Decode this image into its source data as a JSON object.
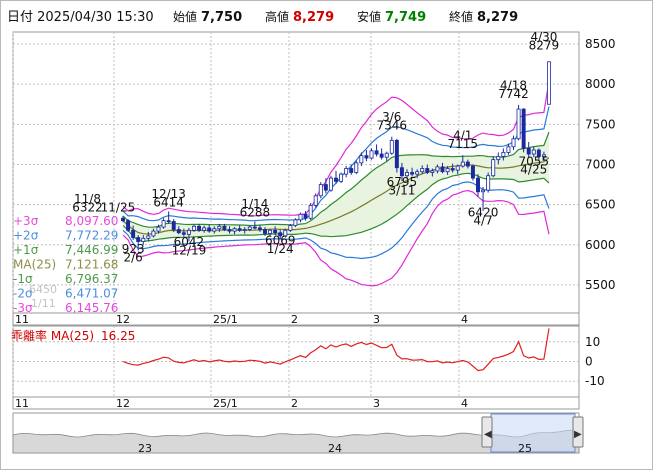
{
  "header": {
    "datetime": "日付 2025/04/30 15:30",
    "open_label": "始値",
    "open": "7,750",
    "high_label": "高値",
    "high": "8,279",
    "low_label": "安値",
    "low": "7,749",
    "close_label": "終値",
    "close": "8,279"
  },
  "colors": {
    "up_candle": "#ffffff",
    "down_candle": "#1a2a9e",
    "candle_edge": "#1a2a9e",
    "ma25": "#7a7a2a",
    "sigma1": "#2e8b2e",
    "sigma2": "#2a7ad8",
    "sigma3": "#e02ad8",
    "band_fill": "#e8f3e0",
    "grid": "#c0c0c0",
    "high_value": "#d00000",
    "low_value": "#008000",
    "deviation_line": "#e02020",
    "navigator_fill": "#c8d8f8"
  },
  "chart_data": {
    "type": "candlestick",
    "main_y_ticks": [
      "8500",
      "8000",
      "7500",
      "7000",
      "6500",
      "6000",
      "5500"
    ],
    "main_ylim": [
      5150,
      8650
    ],
    "x_month_labels": [
      "11",
      "12",
      "25/1",
      "2",
      "3",
      "4"
    ],
    "candles": [
      {
        "o": 6330,
        "h": 6360,
        "l": 6280,
        "c": 6300
      },
      {
        "o": 6300,
        "h": 6320,
        "l": 6160,
        "c": 6180
      },
      {
        "o": 6180,
        "h": 6240,
        "l": 6060,
        "c": 6090
      },
      {
        "o": 6090,
        "h": 6120,
        "l": 5930,
        "c": 6040
      },
      {
        "o": 6040,
        "h": 6120,
        "l": 6000,
        "c": 6080
      },
      {
        "o": 6080,
        "h": 6160,
        "l": 6040,
        "c": 6110
      },
      {
        "o": 6110,
        "h": 6200,
        "l": 6090,
        "c": 6170
      },
      {
        "o": 6170,
        "h": 6250,
        "l": 6140,
        "c": 6220
      },
      {
        "o": 6220,
        "h": 6330,
        "l": 6200,
        "c": 6300
      },
      {
        "o": 6300,
        "h": 6414,
        "l": 6260,
        "c": 6290
      },
      {
        "o": 6290,
        "h": 6320,
        "l": 6160,
        "c": 6190
      },
      {
        "o": 6190,
        "h": 6230,
        "l": 6130,
        "c": 6150
      },
      {
        "o": 6150,
        "h": 6200,
        "l": 6100,
        "c": 6130
      },
      {
        "o": 6130,
        "h": 6210,
        "l": 6042,
        "c": 6180
      },
      {
        "o": 6180,
        "h": 6250,
        "l": 6160,
        "c": 6230
      },
      {
        "o": 6230,
        "h": 6260,
        "l": 6160,
        "c": 6180
      },
      {
        "o": 6180,
        "h": 6240,
        "l": 6150,
        "c": 6210
      },
      {
        "o": 6210,
        "h": 6250,
        "l": 6150,
        "c": 6170
      },
      {
        "o": 6170,
        "h": 6230,
        "l": 6140,
        "c": 6200
      },
      {
        "o": 6200,
        "h": 6260,
        "l": 6160,
        "c": 6230
      },
      {
        "o": 6230,
        "h": 6260,
        "l": 6170,
        "c": 6190
      },
      {
        "o": 6190,
        "h": 6230,
        "l": 6140,
        "c": 6170
      },
      {
        "o": 6170,
        "h": 6220,
        "l": 6130,
        "c": 6200
      },
      {
        "o": 6200,
        "h": 6240,
        "l": 6160,
        "c": 6180
      },
      {
        "o": 6180,
        "h": 6220,
        "l": 6140,
        "c": 6190
      },
      {
        "o": 6190,
        "h": 6240,
        "l": 6170,
        "c": 6220
      },
      {
        "o": 6220,
        "h": 6288,
        "l": 6190,
        "c": 6210
      },
      {
        "o": 6210,
        "h": 6250,
        "l": 6160,
        "c": 6190
      },
      {
        "o": 6190,
        "h": 6220,
        "l": 6110,
        "c": 6140
      },
      {
        "o": 6140,
        "h": 6200,
        "l": 6100,
        "c": 6180
      },
      {
        "o": 6180,
        "h": 6230,
        "l": 6120,
        "c": 6150
      },
      {
        "o": 6150,
        "h": 6190,
        "l": 6069,
        "c": 6110
      },
      {
        "o": 6110,
        "h": 6200,
        "l": 6090,
        "c": 6180
      },
      {
        "o": 6180,
        "h": 6260,
        "l": 6160,
        "c": 6240
      },
      {
        "o": 6240,
        "h": 6330,
        "l": 6220,
        "c": 6310
      },
      {
        "o": 6310,
        "h": 6400,
        "l": 6280,
        "c": 6380
      },
      {
        "o": 6380,
        "h": 6420,
        "l": 6300,
        "c": 6330
      },
      {
        "o": 6330,
        "h": 6520,
        "l": 6310,
        "c": 6490
      },
      {
        "o": 6490,
        "h": 6640,
        "l": 6460,
        "c": 6610
      },
      {
        "o": 6610,
        "h": 6780,
        "l": 6580,
        "c": 6750
      },
      {
        "o": 6750,
        "h": 6830,
        "l": 6640,
        "c": 6680
      },
      {
        "o": 6680,
        "h": 6860,
        "l": 6660,
        "c": 6830
      },
      {
        "o": 6830,
        "h": 6920,
        "l": 6760,
        "c": 6790
      },
      {
        "o": 6790,
        "h": 6900,
        "l": 6770,
        "c": 6880
      },
      {
        "o": 6880,
        "h": 6980,
        "l": 6840,
        "c": 6950
      },
      {
        "o": 6950,
        "h": 7000,
        "l": 6870,
        "c": 6900
      },
      {
        "o": 6900,
        "h": 7050,
        "l": 6880,
        "c": 7020
      },
      {
        "o": 7020,
        "h": 7150,
        "l": 6980,
        "c": 7110
      },
      {
        "o": 7110,
        "h": 7180,
        "l": 7040,
        "c": 7080
      },
      {
        "o": 7080,
        "h": 7200,
        "l": 7060,
        "c": 7170
      },
      {
        "o": 7170,
        "h": 7250,
        "l": 7100,
        "c": 7130
      },
      {
        "o": 7130,
        "h": 7200,
        "l": 7060,
        "c": 7090
      },
      {
        "o": 7090,
        "h": 7160,
        "l": 7040,
        "c": 7140
      },
      {
        "o": 7140,
        "h": 7346,
        "l": 7120,
        "c": 7300
      },
      {
        "o": 7300,
        "h": 7320,
        "l": 6900,
        "c": 6960
      },
      {
        "o": 6960,
        "h": 7020,
        "l": 6795,
        "c": 6860
      },
      {
        "o": 6860,
        "h": 6940,
        "l": 6820,
        "c": 6900
      },
      {
        "o": 6900,
        "h": 6960,
        "l": 6850,
        "c": 6880
      },
      {
        "o": 6880,
        "h": 6940,
        "l": 6830,
        "c": 6910
      },
      {
        "o": 6910,
        "h": 6990,
        "l": 6880,
        "c": 6950
      },
      {
        "o": 6950,
        "h": 7000,
        "l": 6880,
        "c": 6900
      },
      {
        "o": 6900,
        "h": 6950,
        "l": 6850,
        "c": 6920
      },
      {
        "o": 6920,
        "h": 7000,
        "l": 6890,
        "c": 6970
      },
      {
        "o": 6970,
        "h": 7020,
        "l": 6890,
        "c": 6910
      },
      {
        "o": 6910,
        "h": 6980,
        "l": 6870,
        "c": 6950
      },
      {
        "o": 6950,
        "h": 7010,
        "l": 6900,
        "c": 6930
      },
      {
        "o": 6930,
        "h": 7000,
        "l": 6880,
        "c": 6980
      },
      {
        "o": 6980,
        "h": 7115,
        "l": 6960,
        "c": 7030
      },
      {
        "o": 7030,
        "h": 7060,
        "l": 6950,
        "c": 6980
      },
      {
        "o": 6980,
        "h": 7000,
        "l": 6800,
        "c": 6830
      },
      {
        "o": 6830,
        "h": 6880,
        "l": 6600,
        "c": 6660
      },
      {
        "o": 6660,
        "h": 6720,
        "l": 6420,
        "c": 6680
      },
      {
        "o": 6680,
        "h": 6900,
        "l": 6650,
        "c": 6860
      },
      {
        "o": 6860,
        "h": 7100,
        "l": 6840,
        "c": 7060
      },
      {
        "o": 7060,
        "h": 7150,
        "l": 7000,
        "c": 7100
      },
      {
        "o": 7100,
        "h": 7200,
        "l": 7050,
        "c": 7150
      },
      {
        "o": 7150,
        "h": 7260,
        "l": 7120,
        "c": 7220
      },
      {
        "o": 7220,
        "h": 7360,
        "l": 7180,
        "c": 7320
      },
      {
        "o": 7320,
        "h": 7742,
        "l": 7300,
        "c": 7690
      },
      {
        "o": 7690,
        "h": 7700,
        "l": 7150,
        "c": 7200
      },
      {
        "o": 7200,
        "h": 7280,
        "l": 7080,
        "c": 7130
      },
      {
        "o": 7130,
        "h": 7220,
        "l": 7090,
        "c": 7180
      },
      {
        "o": 7180,
        "h": 7200,
        "l": 7055,
        "c": 7100
      },
      {
        "o": 7100,
        "h": 7160,
        "l": 7060,
        "c": 7120
      },
      {
        "o": 7750,
        "h": 8279,
        "l": 7749,
        "c": 8279
      }
    ],
    "annotations": [
      {
        "text": "11/8",
        "i": -7,
        "v": 6520,
        "anchor": "middle"
      },
      {
        "text": "6322",
        "i": -7,
        "v": 6415,
        "anchor": "middle"
      },
      {
        "text": "11/25",
        "i": -1,
        "v": 6415,
        "anchor": "middle"
      },
      {
        "text": "12/13",
        "i": 9,
        "v": 6580,
        "anchor": "middle"
      },
      {
        "text": "6414",
        "i": 9,
        "v": 6475,
        "anchor": "middle"
      },
      {
        "text": "6042",
        "i": 13,
        "v": 5985,
        "anchor": "middle"
      },
      {
        "text": "12/19",
        "i": 13,
        "v": 5880,
        "anchor": "middle"
      },
      {
        "text": "923",
        "i": 2,
        "v": 5895,
        "anchor": "middle"
      },
      {
        "text": "2/6",
        "i": 2,
        "v": 5790,
        "anchor": "middle"
      },
      {
        "text": "1/14",
        "i": 26,
        "v": 6455,
        "anchor": "middle"
      },
      {
        "text": "6288",
        "i": 26,
        "v": 6350,
        "anchor": "middle"
      },
      {
        "text": "6069",
        "i": 31,
        "v": 6005,
        "anchor": "middle"
      },
      {
        "text": "1/24",
        "i": 31,
        "v": 5900,
        "anchor": "middle"
      },
      {
        "text": "3/6",
        "i": 53,
        "v": 7540,
        "anchor": "middle"
      },
      {
        "text": "7346",
        "i": 53,
        "v": 7435,
        "anchor": "middle"
      },
      {
        "text": "6795",
        "i": 55,
        "v": 6730,
        "anchor": "middle"
      },
      {
        "text": "3/11",
        "i": 55,
        "v": 6625,
        "anchor": "middle"
      },
      {
        "text": "4/1",
        "i": 67,
        "v": 7310,
        "anchor": "middle"
      },
      {
        "text": "7115",
        "i": 67,
        "v": 7205,
        "anchor": "middle"
      },
      {
        "text": "6420",
        "i": 71,
        "v": 6355,
        "anchor": "middle"
      },
      {
        "text": "4/7",
        "i": 71,
        "v": 6250,
        "anchor": "middle"
      },
      {
        "text": "4/18",
        "i": 77,
        "v": 7935,
        "anchor": "middle"
      },
      {
        "text": "7742",
        "i": 77,
        "v": 7830,
        "anchor": "middle"
      },
      {
        "text": "7055",
        "i": 81,
        "v": 6990,
        "anchor": "middle"
      },
      {
        "text": "4/25",
        "i": 81,
        "v": 6885,
        "anchor": "middle"
      },
      {
        "text": "4/30",
        "i": 83,
        "v": 8540,
        "anchor": "middle"
      },
      {
        "text": "8279",
        "i": 83,
        "v": 8435,
        "anchor": "middle"
      }
    ],
    "legend": [
      {
        "label": "+3σ",
        "value": "8,097.60",
        "color": "#e02ad8"
      },
      {
        "label": "+2σ",
        "value": "7,772.29",
        "color": "#2a7ad8"
      },
      {
        "label": "+1σ",
        "value": "7,446.99",
        "color": "#2e8b2e"
      },
      {
        "label": "MA(25)",
        "value": "7,121.68",
        "color": "#7a7a2a"
      },
      {
        "label": "-1σ",
        "value": "6,796.37",
        "color": "#2e8b2e"
      },
      {
        "label": "-2σ",
        "value": "6,471.07",
        "color": "#2a7ad8"
      },
      {
        "label": "-3σ",
        "value": "6,145.76",
        "color": "#e02ad8"
      }
    ],
    "legend_obscured_text": [
      "6450",
      "1/11"
    ],
    "deviation": {
      "label": "乖離率 MA(25)",
      "value": "16.25",
      "y_ticks": [
        "10",
        "0",
        "-10"
      ],
      "ylim": [
        -18,
        18
      ]
    },
    "navigator": {
      "labels": [
        "23",
        "24",
        "25"
      ]
    }
  }
}
